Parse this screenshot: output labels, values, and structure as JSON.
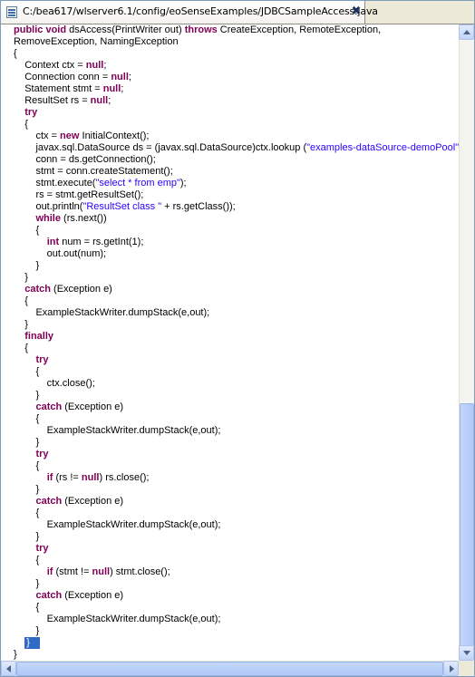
{
  "tab": {
    "title": "C:/bea617/wlserver6.1/config/eoSenseExamples/JDBCSampleAccess.java",
    "close_glyph": "✖",
    "icon": "java-file-icon"
  },
  "code_lines": [
    [
      {
        "t": "public",
        "k": "kw"
      },
      {
        "t": " "
      },
      {
        "t": "void",
        "k": "kw"
      },
      {
        "t": " dsAccess(PrintWriter out) "
      },
      {
        "t": "throws",
        "k": "kw"
      },
      {
        "t": " CreateException, RemoteException,"
      }
    ],
    [
      {
        "t": "RemoveException, NamingException"
      }
    ],
    [
      {
        "t": "{"
      }
    ],
    [
      {
        "t": "    Context ctx = "
      },
      {
        "t": "null",
        "k": "kw"
      },
      {
        "t": ";"
      }
    ],
    [
      {
        "t": "    Connection conn = "
      },
      {
        "t": "null",
        "k": "kw"
      },
      {
        "t": ";"
      }
    ],
    [
      {
        "t": "    Statement stmt = "
      },
      {
        "t": "null",
        "k": "kw"
      },
      {
        "t": ";"
      }
    ],
    [
      {
        "t": "    ResultSet rs = "
      },
      {
        "t": "null",
        "k": "kw"
      },
      {
        "t": ";"
      }
    ],
    [
      {
        "t": "    "
      },
      {
        "t": "try",
        "k": "kw"
      }
    ],
    [
      {
        "t": "    {"
      }
    ],
    [
      {
        "t": "        ctx = "
      },
      {
        "t": "new",
        "k": "kw"
      },
      {
        "t": " InitialContext();"
      }
    ],
    [
      {
        "t": "        javax.sql.DataSource ds = (javax.sql.DataSource)ctx.lookup ("
      },
      {
        "t": "\"examples-dataSource-demoPool\"",
        "k": "str"
      },
      {
        "t": ");"
      }
    ],
    [
      {
        "t": "        conn = ds.getConnection();"
      }
    ],
    [
      {
        "t": "        stmt = conn.createStatement();"
      }
    ],
    [
      {
        "t": "        stmt.execute("
      },
      {
        "t": "\"select * from emp\"",
        "k": "str"
      },
      {
        "t": ");"
      }
    ],
    [
      {
        "t": "        rs = stmt.getResultSet();"
      }
    ],
    [
      {
        "t": "        out.println("
      },
      {
        "t": "\"ResultSet class \"",
        "k": "str"
      },
      {
        "t": " + rs.getClass());"
      }
    ],
    [
      {
        "t": "        "
      },
      {
        "t": "while",
        "k": "kw"
      },
      {
        "t": " (rs.next())"
      }
    ],
    [
      {
        "t": "        {"
      }
    ],
    [
      {
        "t": "            "
      },
      {
        "t": "int",
        "k": "kw"
      },
      {
        "t": " num = rs.getInt(1);"
      }
    ],
    [
      {
        "t": "            out.out(num);"
      }
    ],
    [
      {
        "t": "        }"
      }
    ],
    [
      {
        "t": "    }"
      }
    ],
    [
      {
        "t": "    "
      },
      {
        "t": "catch",
        "k": "kw"
      },
      {
        "t": " (Exception e)"
      }
    ],
    [
      {
        "t": "    {"
      }
    ],
    [
      {
        "t": "        ExampleStackWriter.dumpStack(e,out);"
      }
    ],
    [
      {
        "t": "    }"
      }
    ],
    [
      {
        "t": "    "
      },
      {
        "t": "finally",
        "k": "kw"
      }
    ],
    [
      {
        "t": "    {"
      }
    ],
    [
      {
        "t": "        "
      },
      {
        "t": "try",
        "k": "kw"
      }
    ],
    [
      {
        "t": "        {"
      }
    ],
    [
      {
        "t": "            ctx.close();"
      }
    ],
    [
      {
        "t": "        }"
      }
    ],
    [
      {
        "t": "        "
      },
      {
        "t": "catch",
        "k": "kw"
      },
      {
        "t": " (Exception e)"
      }
    ],
    [
      {
        "t": "        {"
      }
    ],
    [
      {
        "t": "            ExampleStackWriter.dumpStack(e,out);"
      }
    ],
    [
      {
        "t": "        }"
      }
    ],
    [
      {
        "t": "        "
      },
      {
        "t": "try",
        "k": "kw"
      }
    ],
    [
      {
        "t": "        {"
      }
    ],
    [
      {
        "t": "            "
      },
      {
        "t": "if",
        "k": "kw"
      },
      {
        "t": " (rs != "
      },
      {
        "t": "null",
        "k": "kw"
      },
      {
        "t": ") rs.close();"
      }
    ],
    [
      {
        "t": "        }"
      }
    ],
    [
      {
        "t": "        "
      },
      {
        "t": "catch",
        "k": "kw"
      },
      {
        "t": " (Exception e)"
      }
    ],
    [
      {
        "t": "        {"
      }
    ],
    [
      {
        "t": "            ExampleStackWriter.dumpStack(e,out);"
      }
    ],
    [
      {
        "t": "        }"
      }
    ],
    [
      {
        "t": "        "
      },
      {
        "t": "try",
        "k": "kw"
      }
    ],
    [
      {
        "t": "        {"
      }
    ],
    [
      {
        "t": "            "
      },
      {
        "t": "if",
        "k": "kw"
      },
      {
        "t": " (stmt != "
      },
      {
        "t": "null",
        "k": "kw"
      },
      {
        "t": ") stmt.close();"
      }
    ],
    [
      {
        "t": "        }"
      }
    ],
    [
      {
        "t": "        "
      },
      {
        "t": "catch",
        "k": "kw"
      },
      {
        "t": " (Exception e)"
      }
    ],
    [
      {
        "t": "        {"
      }
    ],
    [
      {
        "t": "            ExampleStackWriter.dumpStack(e,out);"
      }
    ],
    [
      {
        "t": "        }"
      }
    ],
    [
      {
        "t": "    "
      },
      {
        "t": "}",
        "k": "cursor"
      }
    ],
    [
      {
        "t": "}"
      }
    ]
  ],
  "colors": {
    "keyword": "#7f0055",
    "string": "#2a00ff",
    "selection": "#316ac5"
  },
  "icons": {
    "vscroll_up": "arrow-up-icon",
    "vscroll_down": "arrow-down-icon",
    "hscroll_left": "arrow-left-icon",
    "hscroll_right": "arrow-right-icon"
  }
}
